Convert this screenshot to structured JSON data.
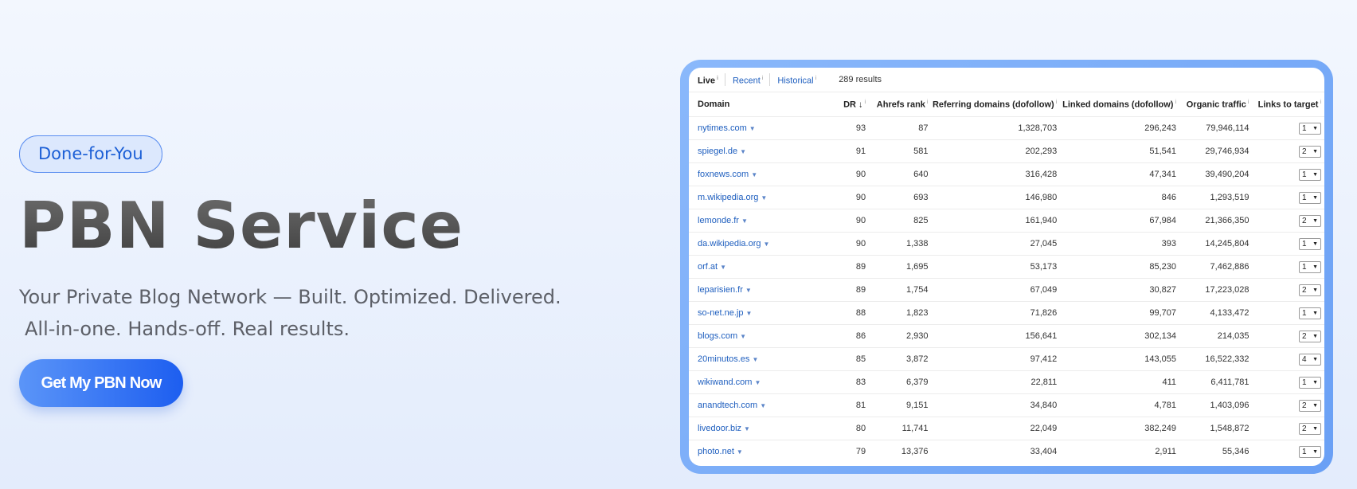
{
  "hero": {
    "badge": "Done-for-You",
    "title": "PBN Service",
    "subtitle_line1": "Your Private Blog Network — Built. Optimized. Delivered.",
    "subtitle_line2": "All-in-one. Hands-off. Real results.",
    "cta_label": "Get My PBN Now"
  },
  "table": {
    "tabs": [
      "Live",
      "Recent",
      "Historical"
    ],
    "results_count": "289 results",
    "columns": [
      "Domain",
      "DR",
      "Ahrefs rank",
      "Referring domains (dofollow)",
      "Linked domains (dofollow)",
      "Organic traffic",
      "Links to target"
    ],
    "info_marker": "i",
    "sort_marker": "↓",
    "rows": [
      {
        "domain": "nytimes.com",
        "dr": "93",
        "rank": "87",
        "ref": "1,328,703",
        "linked": "296,243",
        "organic": "79,946,114",
        "links": "1"
      },
      {
        "domain": "spiegel.de",
        "dr": "91",
        "rank": "581",
        "ref": "202,293",
        "linked": "51,541",
        "organic": "29,746,934",
        "links": "2"
      },
      {
        "domain": "foxnews.com",
        "dr": "90",
        "rank": "640",
        "ref": "316,428",
        "linked": "47,341",
        "organic": "39,490,204",
        "links": "1"
      },
      {
        "domain": "m.wikipedia.org",
        "dr": "90",
        "rank": "693",
        "ref": "146,980",
        "linked": "846",
        "organic": "1,293,519",
        "links": "1"
      },
      {
        "domain": "lemonde.fr",
        "dr": "90",
        "rank": "825",
        "ref": "161,940",
        "linked": "67,984",
        "organic": "21,366,350",
        "links": "2"
      },
      {
        "domain": "da.wikipedia.org",
        "dr": "90",
        "rank": "1,338",
        "ref": "27,045",
        "linked": "393",
        "organic": "14,245,804",
        "links": "1"
      },
      {
        "domain": "orf.at",
        "dr": "89",
        "rank": "1,695",
        "ref": "53,173",
        "linked": "85,230",
        "organic": "7,462,886",
        "links": "1"
      },
      {
        "domain": "leparisien.fr",
        "dr": "89",
        "rank": "1,754",
        "ref": "67,049",
        "linked": "30,827",
        "organic": "17,223,028",
        "links": "2"
      },
      {
        "domain": "so-net.ne.jp",
        "dr": "88",
        "rank": "1,823",
        "ref": "71,826",
        "linked": "99,707",
        "organic": "4,133,472",
        "links": "1"
      },
      {
        "domain": "blogs.com",
        "dr": "86",
        "rank": "2,930",
        "ref": "156,641",
        "linked": "302,134",
        "organic": "214,035",
        "links": "2"
      },
      {
        "domain": "20minutos.es",
        "dr": "85",
        "rank": "3,872",
        "ref": "97,412",
        "linked": "143,055",
        "organic": "16,522,332",
        "links": "4"
      },
      {
        "domain": "wikiwand.com",
        "dr": "83",
        "rank": "6,379",
        "ref": "22,811",
        "linked": "411",
        "organic": "6,411,781",
        "links": "1"
      },
      {
        "domain": "anandtech.com",
        "dr": "81",
        "rank": "9,151",
        "ref": "34,840",
        "linked": "4,781",
        "organic": "1,403,096",
        "links": "2"
      },
      {
        "domain": "livedoor.biz",
        "dr": "80",
        "rank": "11,741",
        "ref": "22,049",
        "linked": "382,249",
        "organic": "1,548,872",
        "links": "2"
      },
      {
        "domain": "photo.net",
        "dr": "79",
        "rank": "13,376",
        "ref": "33,404",
        "linked": "2,911",
        "organic": "55,346",
        "links": "1"
      }
    ]
  },
  "colors": {
    "accent": "#1d5ef0",
    "link": "#1f5fbf",
    "panel_border": "#7aaaf8"
  },
  "icons": {
    "caret": "caret-down-icon",
    "select_arrow": "select-arrow-icon"
  }
}
